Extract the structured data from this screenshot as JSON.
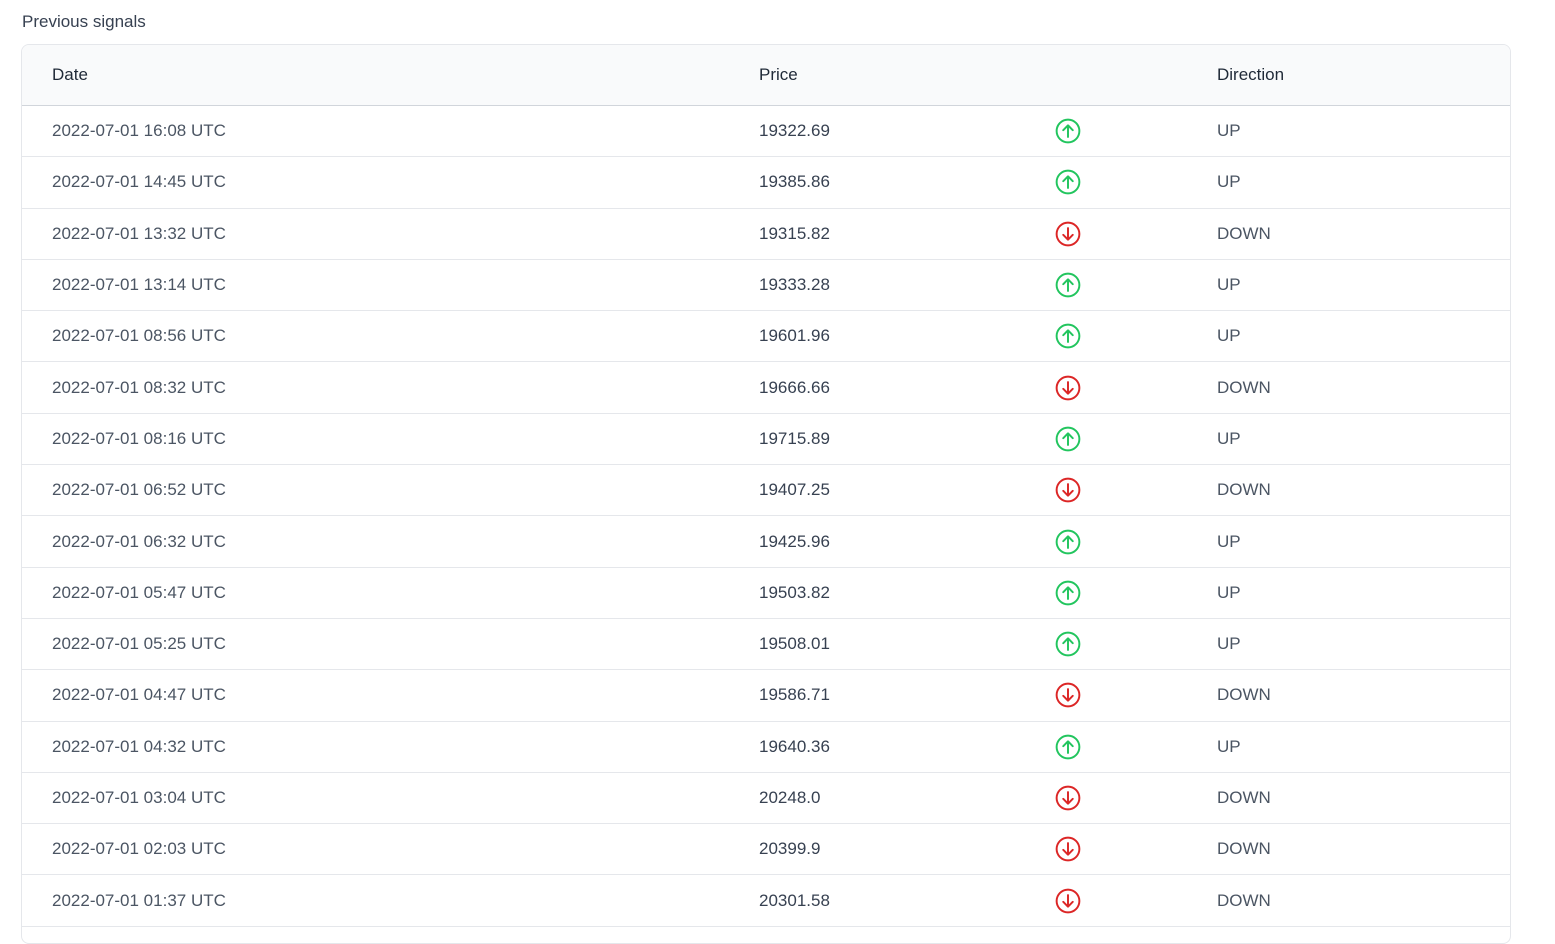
{
  "section": {
    "title": "Previous signals"
  },
  "table": {
    "headers": {
      "date": "Date",
      "price": "Price",
      "direction": "Direction"
    },
    "colors": {
      "up": "#22c55e",
      "down": "#dc2626"
    },
    "rows": [
      {
        "date": "2022-07-01 16:08 UTC",
        "price": "19322.69",
        "icon": "arrow-up-circle-icon",
        "direction": "UP"
      },
      {
        "date": "2022-07-01 14:45 UTC",
        "price": "19385.86",
        "icon": "arrow-up-circle-icon",
        "direction": "UP"
      },
      {
        "date": "2022-07-01 13:32 UTC",
        "price": "19315.82",
        "icon": "arrow-down-circle-icon",
        "direction": "DOWN"
      },
      {
        "date": "2022-07-01 13:14 UTC",
        "price": "19333.28",
        "icon": "arrow-up-circle-icon",
        "direction": "UP"
      },
      {
        "date": "2022-07-01 08:56 UTC",
        "price": "19601.96",
        "icon": "arrow-up-circle-icon",
        "direction": "UP"
      },
      {
        "date": "2022-07-01 08:32 UTC",
        "price": "19666.66",
        "icon": "arrow-down-circle-icon",
        "direction": "DOWN"
      },
      {
        "date": "2022-07-01 08:16 UTC",
        "price": "19715.89",
        "icon": "arrow-up-circle-icon",
        "direction": "UP"
      },
      {
        "date": "2022-07-01 06:52 UTC",
        "price": "19407.25",
        "icon": "arrow-down-circle-icon",
        "direction": "DOWN"
      },
      {
        "date": "2022-07-01 06:32 UTC",
        "price": "19425.96",
        "icon": "arrow-up-circle-icon",
        "direction": "UP"
      },
      {
        "date": "2022-07-01 05:47 UTC",
        "price": "19503.82",
        "icon": "arrow-up-circle-icon",
        "direction": "UP"
      },
      {
        "date": "2022-07-01 05:25 UTC",
        "price": "19508.01",
        "icon": "arrow-up-circle-icon",
        "direction": "UP"
      },
      {
        "date": "2022-07-01 04:47 UTC",
        "price": "19586.71",
        "icon": "arrow-down-circle-icon",
        "direction": "DOWN"
      },
      {
        "date": "2022-07-01 04:32 UTC",
        "price": "19640.36",
        "icon": "arrow-up-circle-icon",
        "direction": "UP"
      },
      {
        "date": "2022-07-01 03:04 UTC",
        "price": "20248.0",
        "icon": "arrow-down-circle-icon",
        "direction": "DOWN"
      },
      {
        "date": "2022-07-01 02:03 UTC",
        "price": "20399.9",
        "icon": "arrow-down-circle-icon",
        "direction": "DOWN"
      },
      {
        "date": "2022-07-01 01:37 UTC",
        "price": "20301.58",
        "icon": "arrow-down-circle-icon",
        "direction": "DOWN"
      }
    ]
  }
}
